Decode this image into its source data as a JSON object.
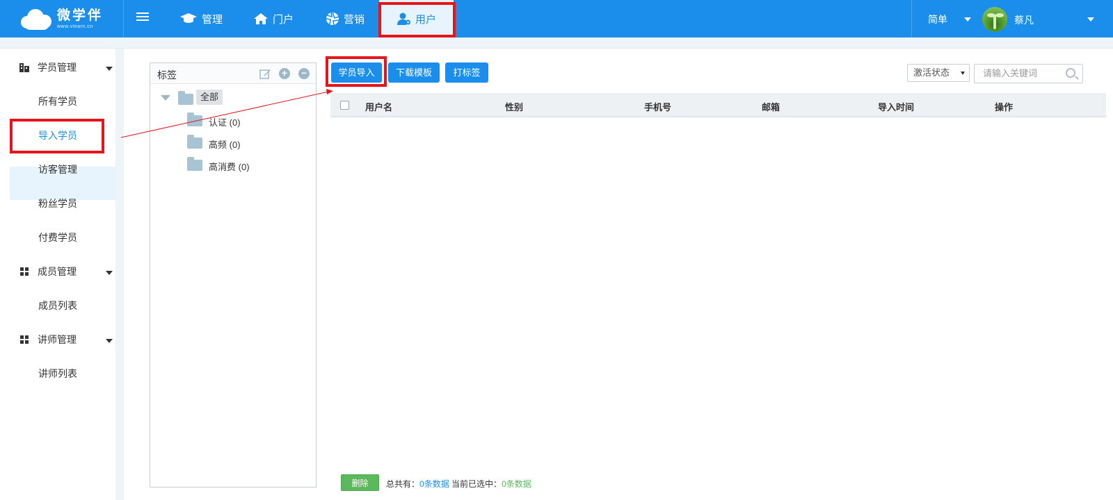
{
  "app": {
    "logo_text": "微学伴",
    "logo_sub": "www.vlearn.cn",
    "username": "蔡凡",
    "mode": "简单"
  },
  "topnav": {
    "items": [
      {
        "label": "管理",
        "icon": "graduation-cap-icon"
      },
      {
        "label": "门户",
        "icon": "home-icon"
      },
      {
        "label": "营销",
        "icon": "aperture-icon"
      },
      {
        "label": "用户",
        "icon": "user-settings-icon",
        "active": true
      }
    ]
  },
  "sidebar": {
    "groups": [
      {
        "label": "学员管理",
        "icon": "building-icon",
        "items": [
          "所有学员",
          "导入学员",
          "访客管理",
          "粉丝学员",
          "付费学员"
        ]
      },
      {
        "label": "成员管理",
        "icon": "grid-icon",
        "items": [
          "成员列表"
        ]
      },
      {
        "label": "讲师管理",
        "icon": "grid-icon",
        "items": [
          "讲师列表"
        ]
      }
    ],
    "active_item": "导入学员"
  },
  "tags": {
    "title": "标签",
    "root": "全部",
    "children": [
      {
        "name": "认证",
        "count": "(0)"
      },
      {
        "name": "高频",
        "count": "(0)"
      },
      {
        "name": "高消费",
        "count": "(0)"
      }
    ]
  },
  "toolbar": {
    "import_label": "学员导入",
    "template_label": "下载模板",
    "tag_label": "打标签",
    "status_select": "激活状态",
    "search_placeholder": "请输入关键词"
  },
  "table": {
    "columns": [
      "用户名",
      "性别",
      "手机号",
      "邮箱",
      "导入时间",
      "操作"
    ],
    "rows": []
  },
  "footer": {
    "delete_label": "删除",
    "total_prefix": "总共有：",
    "total_value": "0条数据",
    "selected_prefix": "当前已选中：",
    "selected_value": "0条数据"
  },
  "colors": {
    "primary": "#1a8eea",
    "highlight": "#e8141b",
    "success": "#5cb85c"
  }
}
